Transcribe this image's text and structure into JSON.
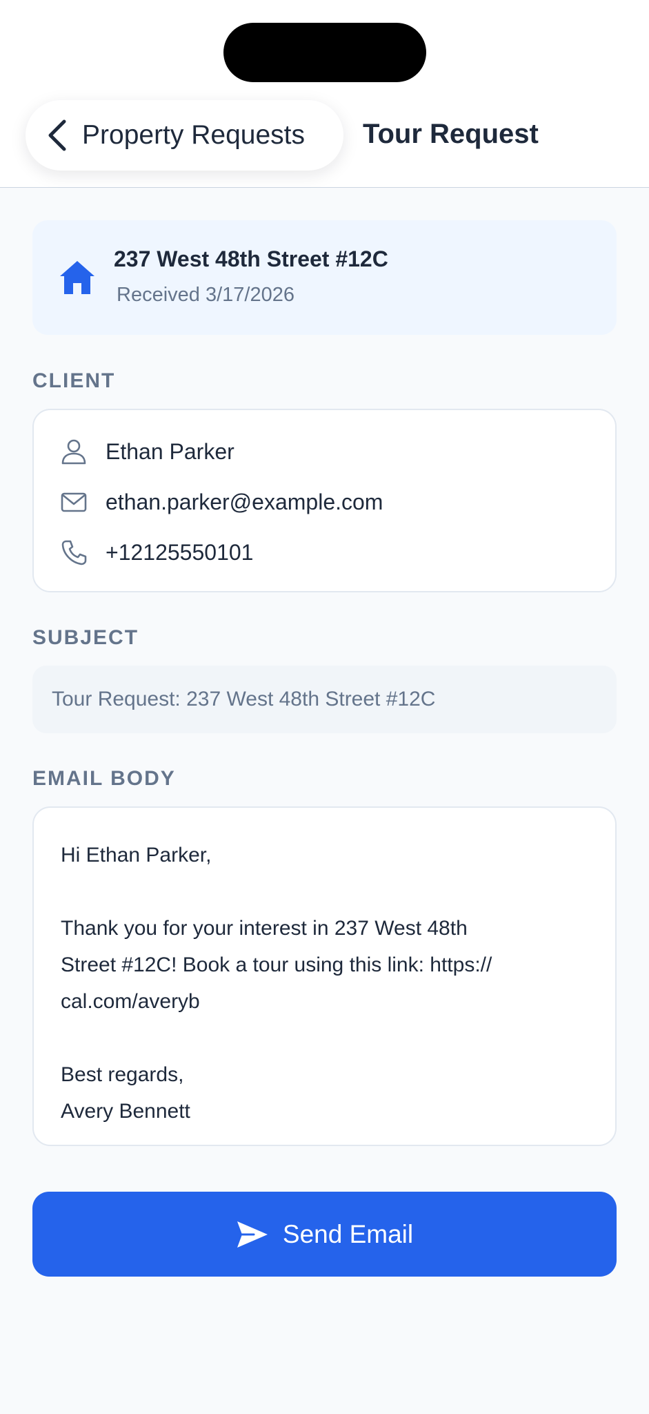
{
  "header": {
    "back_label": "Property Requests",
    "title": "Tour Request"
  },
  "property": {
    "address": "237 West 48th Street #12C",
    "received": "Received 3/17/2026",
    "icon": "home-icon"
  },
  "client": {
    "section_label": "CLIENT",
    "name": "Ethan Parker",
    "email": "ethan.parker@example.com",
    "phone": "+12125550101"
  },
  "subject": {
    "section_label": "SUBJECT",
    "value": "Tour Request: 237 West 48th Street #12C"
  },
  "email_body": {
    "section_label": "EMAIL BODY",
    "text": "Hi Ethan Parker,\n\nThank you for your interest in 237 West 48th\nStreet #12C! Book a tour using this link: https://\ncal.com/averyb\n\nBest regards,\nAvery Bennett"
  },
  "actions": {
    "send_label": "Send Email"
  },
  "colors": {
    "accent": "#2563eb",
    "card_tint": "#eff6ff",
    "muted_text": "#64748b"
  }
}
